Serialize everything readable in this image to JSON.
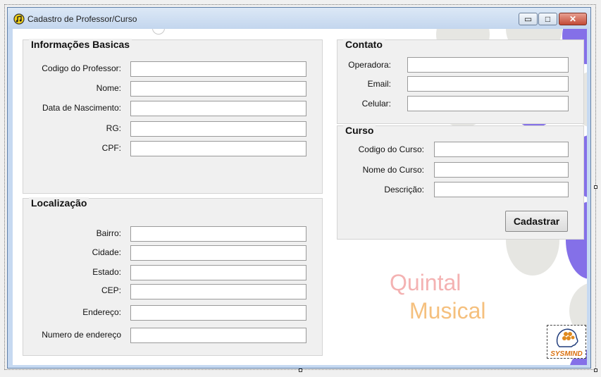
{
  "window": {
    "title": "Cadastro de Professor/Curso",
    "icon": "app-music-icon",
    "controls": {
      "minimize": "▭",
      "maximize": "□",
      "close": "✕"
    }
  },
  "info": {
    "title": "Informações Basicas",
    "fields": [
      {
        "label": "Codigo do Professor:",
        "value": ""
      },
      {
        "label": "Nome:",
        "value": ""
      },
      {
        "label": "Data de Nascimento:",
        "value": ""
      },
      {
        "label": "RG:",
        "value": ""
      },
      {
        "label": "CPF:",
        "value": ""
      }
    ]
  },
  "localizacao": {
    "title": "Localização",
    "fields": [
      {
        "label": "Bairro:",
        "value": ""
      },
      {
        "label": "Cidade:",
        "value": ""
      },
      {
        "label": "Estado:",
        "value": ""
      },
      {
        "label": "CEP:",
        "value": ""
      },
      {
        "label": "Endereço:",
        "value": ""
      },
      {
        "label": "Numero de endereço",
        "value": ""
      }
    ]
  },
  "contato": {
    "title": "Contato",
    "fields": [
      {
        "label": "Operadora:",
        "value": ""
      },
      {
        "label": "Email:",
        "value": ""
      },
      {
        "label": "Celular:",
        "value": ""
      }
    ]
  },
  "curso": {
    "title": "Curso",
    "fields": [
      {
        "label": "Codigo do Curso:",
        "value": ""
      },
      {
        "label": "Nome do Curso:",
        "value": ""
      },
      {
        "label": "Descrição:",
        "value": ""
      }
    ],
    "submit_label": "Cadastrar"
  },
  "brand": {
    "line1": "Quintal",
    "line2": "Musical",
    "logo_text": "SYSMIND",
    "logo_icon": "brain-head-icon"
  },
  "colors": {
    "accent_purple": "#8470e8",
    "gray_circle": "#e6e6e2",
    "brand_pink": "#f4b2b2",
    "brand_orange": "#f5c07e"
  }
}
